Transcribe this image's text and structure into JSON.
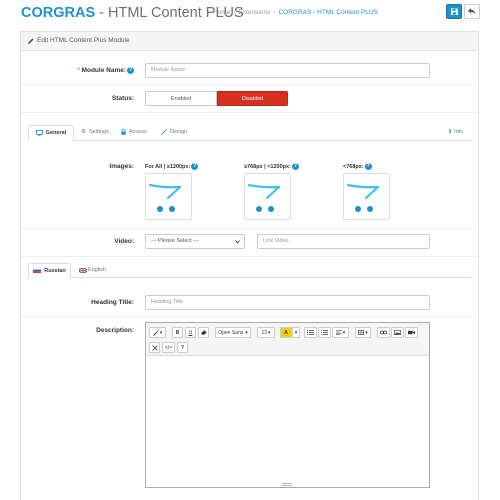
{
  "header": {
    "brand_strong": "CORGRAS",
    "brand_rest": " - HTML Content PLUS",
    "breadcrumbs": [
      "Home",
      "Extensions",
      "CORGRAS - HTML Content PLUS"
    ]
  },
  "panel": {
    "title": "Edit HTML Content Plus Module"
  },
  "form": {
    "module_name": {
      "label": "Module Name:",
      "required_mark": "*",
      "placeholder": "Module Name",
      "value": ""
    },
    "status": {
      "label": "Status:",
      "enabled_label": "Enabled",
      "disabled_label": "Disabled",
      "selected": "Disabled"
    }
  },
  "tabs": {
    "general": "General",
    "settings": "Settings",
    "access": "Access",
    "design": "Design",
    "info": "Info"
  },
  "images": {
    "label": "Images:",
    "columns": [
      "For All | ≥1200px:",
      "≥768px | <1200px:",
      "<768px:"
    ]
  },
  "video": {
    "label": "Video:",
    "select_value": "--- Please Select ---",
    "link_placeholder": "Link Video"
  },
  "languages": {
    "russian": "Russian",
    "english": "English"
  },
  "heading": {
    "label": "Heading Title:",
    "placeholder": "Heading Title"
  },
  "description": {
    "label": "Description:",
    "font_family": "Open Sans",
    "font_size": "13"
  },
  "colors": {
    "accent": "#1e91cf",
    "danger": "#d5301f",
    "cart_icon": "#3cc1e8",
    "highlight": "#f5d000"
  },
  "icons": {
    "save": "floppy-icon",
    "back": "reply-icon",
    "edit": "pencil-icon",
    "help": "question-circle-icon"
  }
}
